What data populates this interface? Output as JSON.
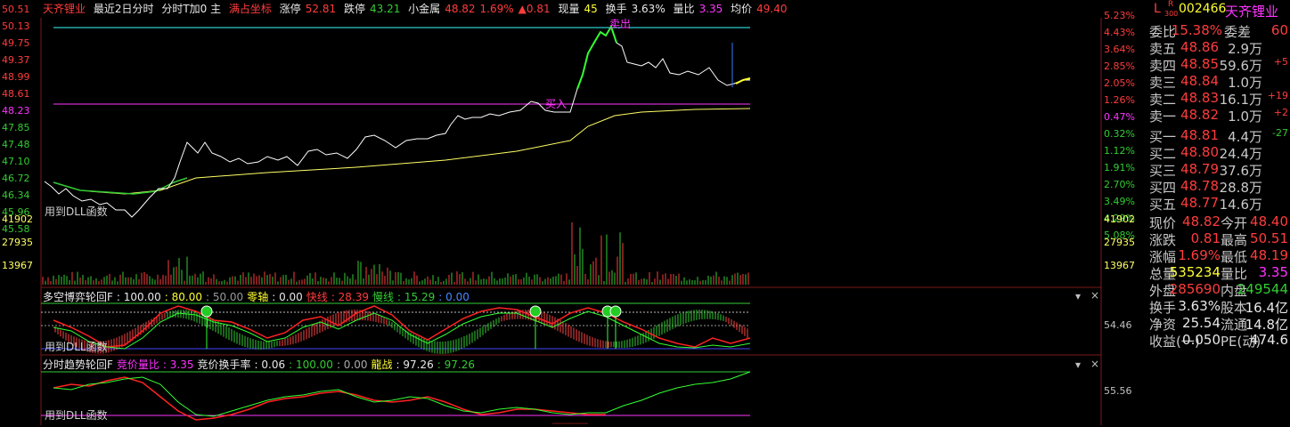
{
  "topbar": {
    "stock_name": "天齐锂业",
    "period_label": "最近2日分时",
    "mode_label": "分时T加0 主",
    "full_coord_label": "满占坐标",
    "limit_up_label": "涨停",
    "limit_up": "52.81",
    "limit_down_label": "跌停",
    "limit_down": "43.21",
    "index_label": "小金属",
    "index_value": "48.82",
    "index_pct": "1.69%",
    "index_change": "▲0.81",
    "volume_label": "现量",
    "volume": "45",
    "turnover_label": "换手",
    "turnover": "3.63%",
    "ratio_label": "量比",
    "ratio": "3.35",
    "avg_label": "均价",
    "avg": "49.40"
  },
  "price_axis_left": [
    "50.51",
    "50.13",
    "49.75",
    "49.37",
    "48.99",
    "48.61",
    "48.23",
    "47.85",
    "47.48",
    "47.10",
    "46.72",
    "46.34",
    "45.96",
    "45.58"
  ],
  "price_axis_right": [
    "5.23%",
    "4.43%",
    "3.64%",
    "2.85%",
    "2.05%",
    "1.26%",
    "0.47%",
    "0.32%",
    "1.12%",
    "1.91%",
    "2.70%",
    "3.49%",
    "4.29%",
    "5.08%"
  ],
  "vol_axis_left": [
    "41902",
    "27935",
    "13967"
  ],
  "vol_axis_right": [
    "41902",
    "27935",
    "13967"
  ],
  "annotations": {
    "buy": "买入",
    "sell": "卖出",
    "dll_note": "用到DLL函数"
  },
  "ind1": {
    "title": "多空博弈轮回F",
    "v1": ": 100.00",
    "v2": ": 80.00",
    "v3": ": 50.00",
    "zero_label": "零轴",
    "zero": ": 0.00",
    "fast_label": "快线",
    "fast": ": 28.39",
    "slow_label": "慢线",
    "slow": ": 15.29",
    "v4": ": 0.00",
    "right_value": "54.46"
  },
  "ind2": {
    "title": "分时趋势轮回F",
    "bid_ratio_label": "竞价量比",
    "bid_ratio": ": 3.35",
    "bid_turn_label": "竞价换手率",
    "bid_turn": ": 0.06",
    "v1": ": 100.00",
    "v2": ": 0.00",
    "fight_label": "龍战",
    "fight": ": 97.26",
    "fight2": ": 97.26",
    "right_value": "55.56"
  },
  "controls": {
    "dropdown": "▾",
    "close": "×"
  },
  "panel": {
    "l_mark": "L",
    "r_mark": "R",
    "r_sub": "300",
    "code": "002466",
    "name": "天齐锂业",
    "commission_ratio_label": "委比",
    "commission_ratio": "15.38%",
    "commission_diff_label": "委差",
    "commission_diff": "60",
    "asks": [
      {
        "label": "卖五",
        "price": "48.86",
        "vol": "2.9万",
        "chg": ""
      },
      {
        "label": "卖四",
        "price": "48.85",
        "vol": "59.6万",
        "chg": "+5"
      },
      {
        "label": "卖三",
        "price": "48.84",
        "vol": "1.0万",
        "chg": ""
      },
      {
        "label": "卖二",
        "price": "48.83",
        "vol": "16.1万",
        "chg": "+19"
      },
      {
        "label": "卖一",
        "price": "48.82",
        "vol": "1.0万",
        "chg": "+2"
      }
    ],
    "bids": [
      {
        "label": "买一",
        "price": "48.81",
        "vol": "4.4万",
        "chg": "-27"
      },
      {
        "label": "买二",
        "price": "48.80",
        "vol": "24.4万",
        "chg": ""
      },
      {
        "label": "买三",
        "price": "48.79",
        "vol": "37.6万",
        "chg": ""
      },
      {
        "label": "买四",
        "price": "48.78",
        "vol": "28.8万",
        "chg": ""
      },
      {
        "label": "买五",
        "price": "48.77",
        "vol": "14.6万",
        "chg": ""
      }
    ],
    "stats": [
      {
        "l1": "现价",
        "v1": "48.82",
        "l2": "今开",
        "v2": "48.40"
      },
      {
        "l1": "涨跌",
        "v1": "0.81",
        "l2": "最高",
        "v2": "50.51"
      },
      {
        "l1": "涨幅",
        "v1": "1.69%",
        "l2": "最低",
        "v2": "48.19"
      },
      {
        "l1": "总量",
        "v1": "535234",
        "l2": "量比",
        "v2": "3.35"
      },
      {
        "l1": "外盘",
        "v1": "285690",
        "l2": "内盘",
        "v2": "249544"
      },
      {
        "l1": "换手",
        "v1": "3.63%",
        "l2": "股本",
        "v2": "16.4亿"
      },
      {
        "l1": "净资",
        "v1": "25.54",
        "l2": "流通",
        "v2": "14.8亿"
      },
      {
        "l1": "收益(一)",
        "v1": "0.050",
        "l2": "PE(动)",
        "v2": "474.6"
      }
    ]
  },
  "colors": {
    "up": "#ff3c3c",
    "down": "#33cc33",
    "price_line": "#ffffff",
    "avg_line": "#ffff66",
    "cyan_line": "#33ffff",
    "magenta_line": "#ff33ff"
  }
}
